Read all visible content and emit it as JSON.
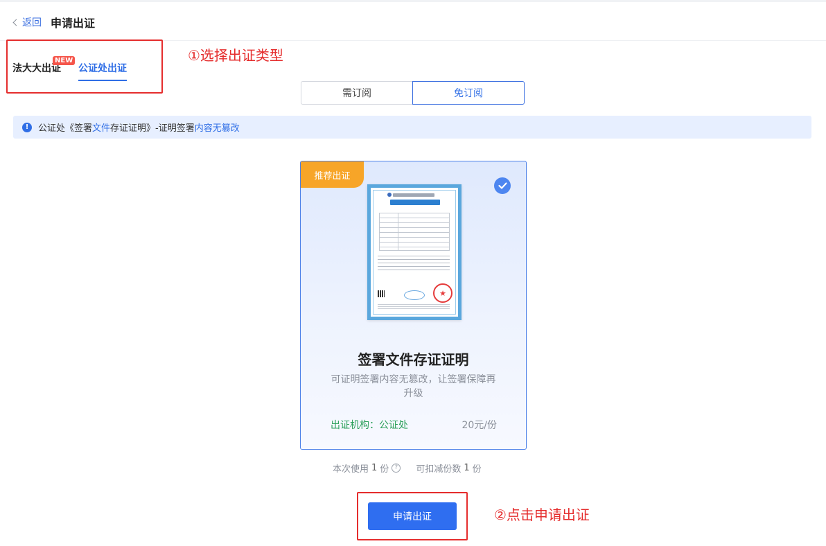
{
  "header": {
    "back_label": "返回",
    "title": "申请出证"
  },
  "type_tabs": {
    "fdd_label": "法大大出证",
    "new_badge": "NEW",
    "gzc_label": "公证处出证",
    "active": "公证处出证"
  },
  "annotations": {
    "step1": "①选择出证类型",
    "step2": "②点击申请出证",
    "color": "#e52d2d"
  },
  "subscription": {
    "left_label": "需订阅",
    "right_label": "免订阅",
    "selected": "免订阅"
  },
  "info": {
    "icon": "exclamation-icon",
    "part1": "公证处《签署",
    "part2": "文件",
    "part3": "存证证明》-证明签署",
    "part4": "内容无篡改"
  },
  "card": {
    "ribbon": "推荐出证",
    "selected": true,
    "title": "签署文件存证证明",
    "description": "可证明签署内容无篡改，让签署保障再升级",
    "org": "出证机构：公证处",
    "price": "20元/份",
    "cert_seal": "★"
  },
  "usage": {
    "use_prefix": "本次使用",
    "use_count": "1",
    "use_unit": "份",
    "help_icon": "?",
    "deduct_prefix": "可扣减份数",
    "deduct_count": "1",
    "deduct_unit": "份"
  },
  "apply_button": "申请出证",
  "colors": {
    "primary": "#2f6ee6",
    "ribbon": "#f7a528",
    "org_green": "#2ca05a",
    "info_bg": "#e7efff"
  }
}
